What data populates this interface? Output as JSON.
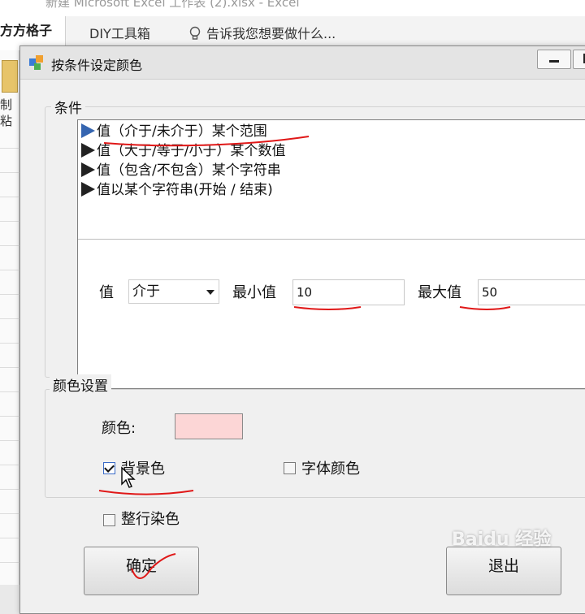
{
  "excel": {
    "window_title": "新建 Microsoft Excel 工作表 (2).xlsx - Excel",
    "ribbon_tabs": [
      "方方格子",
      "DIY工具箱",
      "告诉我您想要做什么..."
    ],
    "left_labels": [
      "制",
      "粘"
    ]
  },
  "dialog": {
    "title": "按条件设定颜色",
    "condition_group": {
      "title": "条件",
      "items": [
        "值（介于/未介于）某个范围",
        "值（大于/等于/小于）某个数值",
        "值（包含/不包含）某个字符串",
        "值以某个字符串(开始 / 结束)"
      ],
      "value_label": "值",
      "operator_value": "介于",
      "min_label": "最小值",
      "min_value": "10",
      "max_label": "最大值",
      "max_value": "50"
    },
    "color_group": {
      "title": "颜色设置",
      "color_label": "颜色:",
      "swatch_color": "#fcd6d6",
      "background_label": "背景色",
      "background_checked": true,
      "font_color_label": "字体颜色",
      "font_color_checked": false
    },
    "whole_row_label": "整行染色",
    "whole_row_checked": false,
    "ok_label": "确定",
    "exit_label": "退出"
  },
  "watermark": "Baidu 经验"
}
